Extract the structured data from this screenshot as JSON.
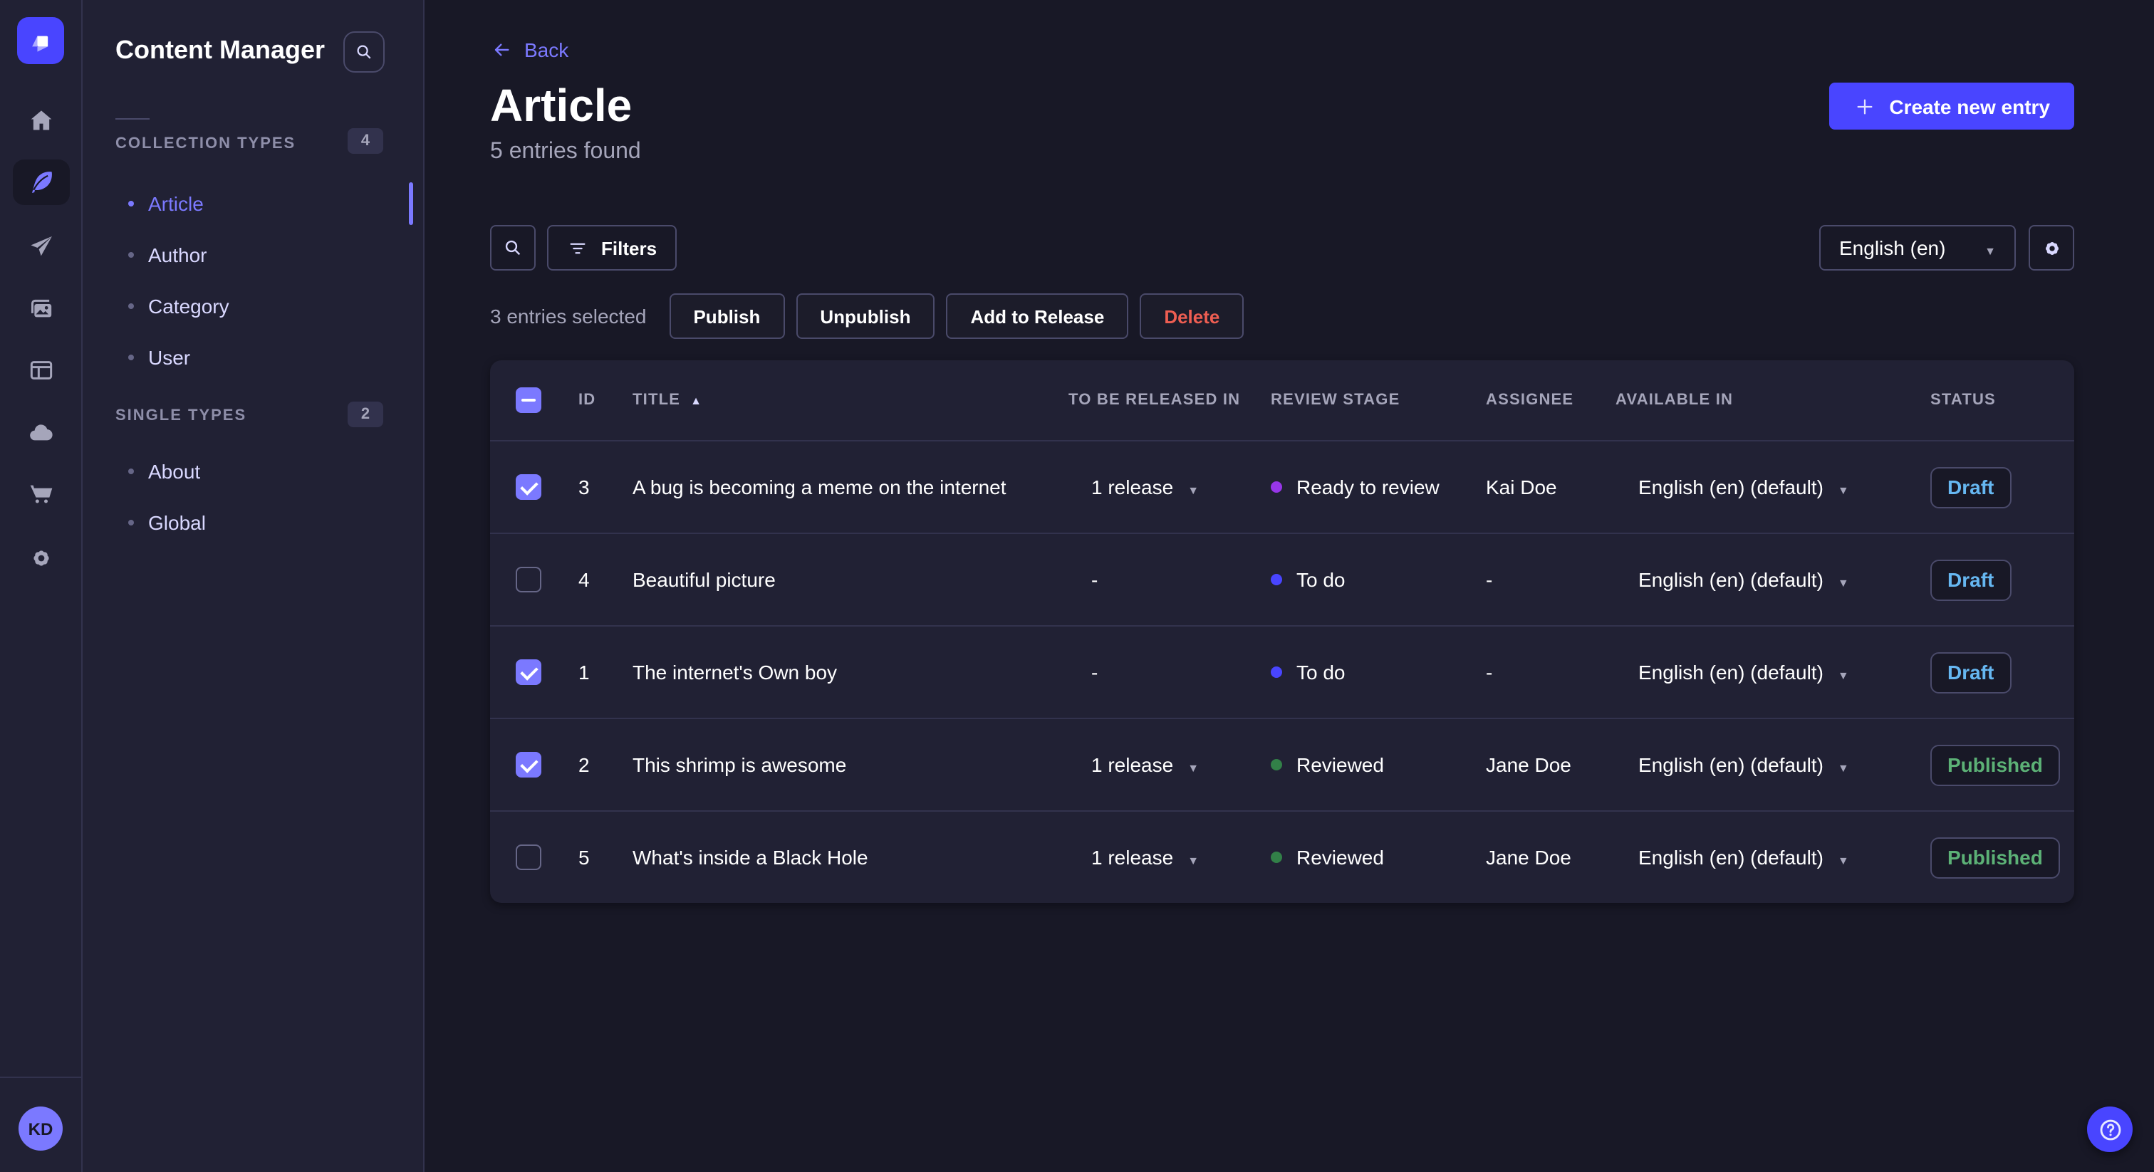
{
  "app": {
    "name": "Strapi admin"
  },
  "rail": {
    "items": [
      {
        "name": "home",
        "icon": "home-icon",
        "active": false
      },
      {
        "name": "content-manager",
        "icon": "feather-icon",
        "active": true
      },
      {
        "name": "releases",
        "icon": "paper-plane-icon",
        "active": false
      },
      {
        "name": "media-library",
        "icon": "images-icon",
        "active": false
      },
      {
        "name": "content-type-builder",
        "icon": "layout-icon",
        "active": false
      },
      {
        "name": "cloud",
        "icon": "cloud-icon",
        "active": false
      },
      {
        "name": "marketplace",
        "icon": "cart-icon",
        "active": false
      },
      {
        "name": "settings",
        "icon": "gear-icon",
        "active": false
      }
    ],
    "avatar_initials": "KD"
  },
  "sidebar": {
    "title": "Content Manager",
    "sections": [
      {
        "label": "COLLECTION TYPES",
        "count": "4",
        "items": [
          {
            "label": "Article"
          },
          {
            "label": "Author"
          },
          {
            "label": "Category"
          },
          {
            "label": "User"
          }
        ]
      },
      {
        "label": "SINGLE TYPES",
        "count": "2",
        "items": [
          {
            "label": "About"
          },
          {
            "label": "Global"
          }
        ]
      }
    ],
    "active_item": "Article"
  },
  "header": {
    "back_label": "Back",
    "title": "Article",
    "subtitle": "5 entries found",
    "create_button": "Create new entry"
  },
  "toolbar": {
    "filters_label": "Filters",
    "locale_value": "English (en)"
  },
  "selection": {
    "text": "3 entries selected",
    "publish_label": "Publish",
    "unpublish_label": "Unpublish",
    "add_to_release_label": "Add to Release",
    "delete_label": "Delete"
  },
  "table": {
    "select_all_state": "indeterminate",
    "columns": {
      "id": "ID",
      "title": "TITLE",
      "release": "TO BE RELEASED IN",
      "review": "REVIEW STAGE",
      "assignee": "ASSIGNEE",
      "available": "AVAILABLE IN",
      "status": "STATUS"
    },
    "sort_column": "TITLE",
    "sort_direction": "ascending",
    "rows": [
      {
        "checked": true,
        "id": "3",
        "title": "A bug is becoming a meme on the internet",
        "release": "1 release",
        "review": "Ready to review",
        "review_color": "#9736e8",
        "assignee": "Kai Doe",
        "available": "English (en) (default)",
        "status": "Draft",
        "status_color": "#66b7f1"
      },
      {
        "checked": false,
        "id": "4",
        "title": "Beautiful picture",
        "release": "-",
        "review": "To do",
        "review_color": "#4945ff",
        "assignee": "-",
        "available": "English (en) (default)",
        "status": "Draft",
        "status_color": "#66b7f1"
      },
      {
        "checked": true,
        "id": "1",
        "title": "The internet's Own boy",
        "release": "-",
        "review": "To do",
        "review_color": "#4945ff",
        "assignee": "-",
        "available": "English (en) (default)",
        "status": "Draft",
        "status_color": "#66b7f1"
      },
      {
        "checked": true,
        "id": "2",
        "title": "This shrimp is awesome",
        "release": "1 release",
        "review": "Reviewed",
        "review_color": "#328048",
        "assignee": "Jane Doe",
        "available": "English (en) (default)",
        "status": "Published",
        "status_color": "#5cb176"
      },
      {
        "checked": false,
        "id": "5",
        "title": "What's inside a Black Hole",
        "release": "1 release",
        "review": "Reviewed",
        "review_color": "#328048",
        "assignee": "Jane Doe",
        "available": "English (en) (default)",
        "status": "Published",
        "status_color": "#5cb176"
      }
    ]
  },
  "colors": {
    "primary": "#4945ff",
    "primary_light": "#7b79ff",
    "background": "#181826",
    "surface": "#212134",
    "border": "#32324d",
    "control_border": "#4a4a6a",
    "text_muted": "#a5a5ba",
    "danger": "#ee5e52",
    "success": "#5cb176",
    "draft_blue": "#66b7f1"
  }
}
